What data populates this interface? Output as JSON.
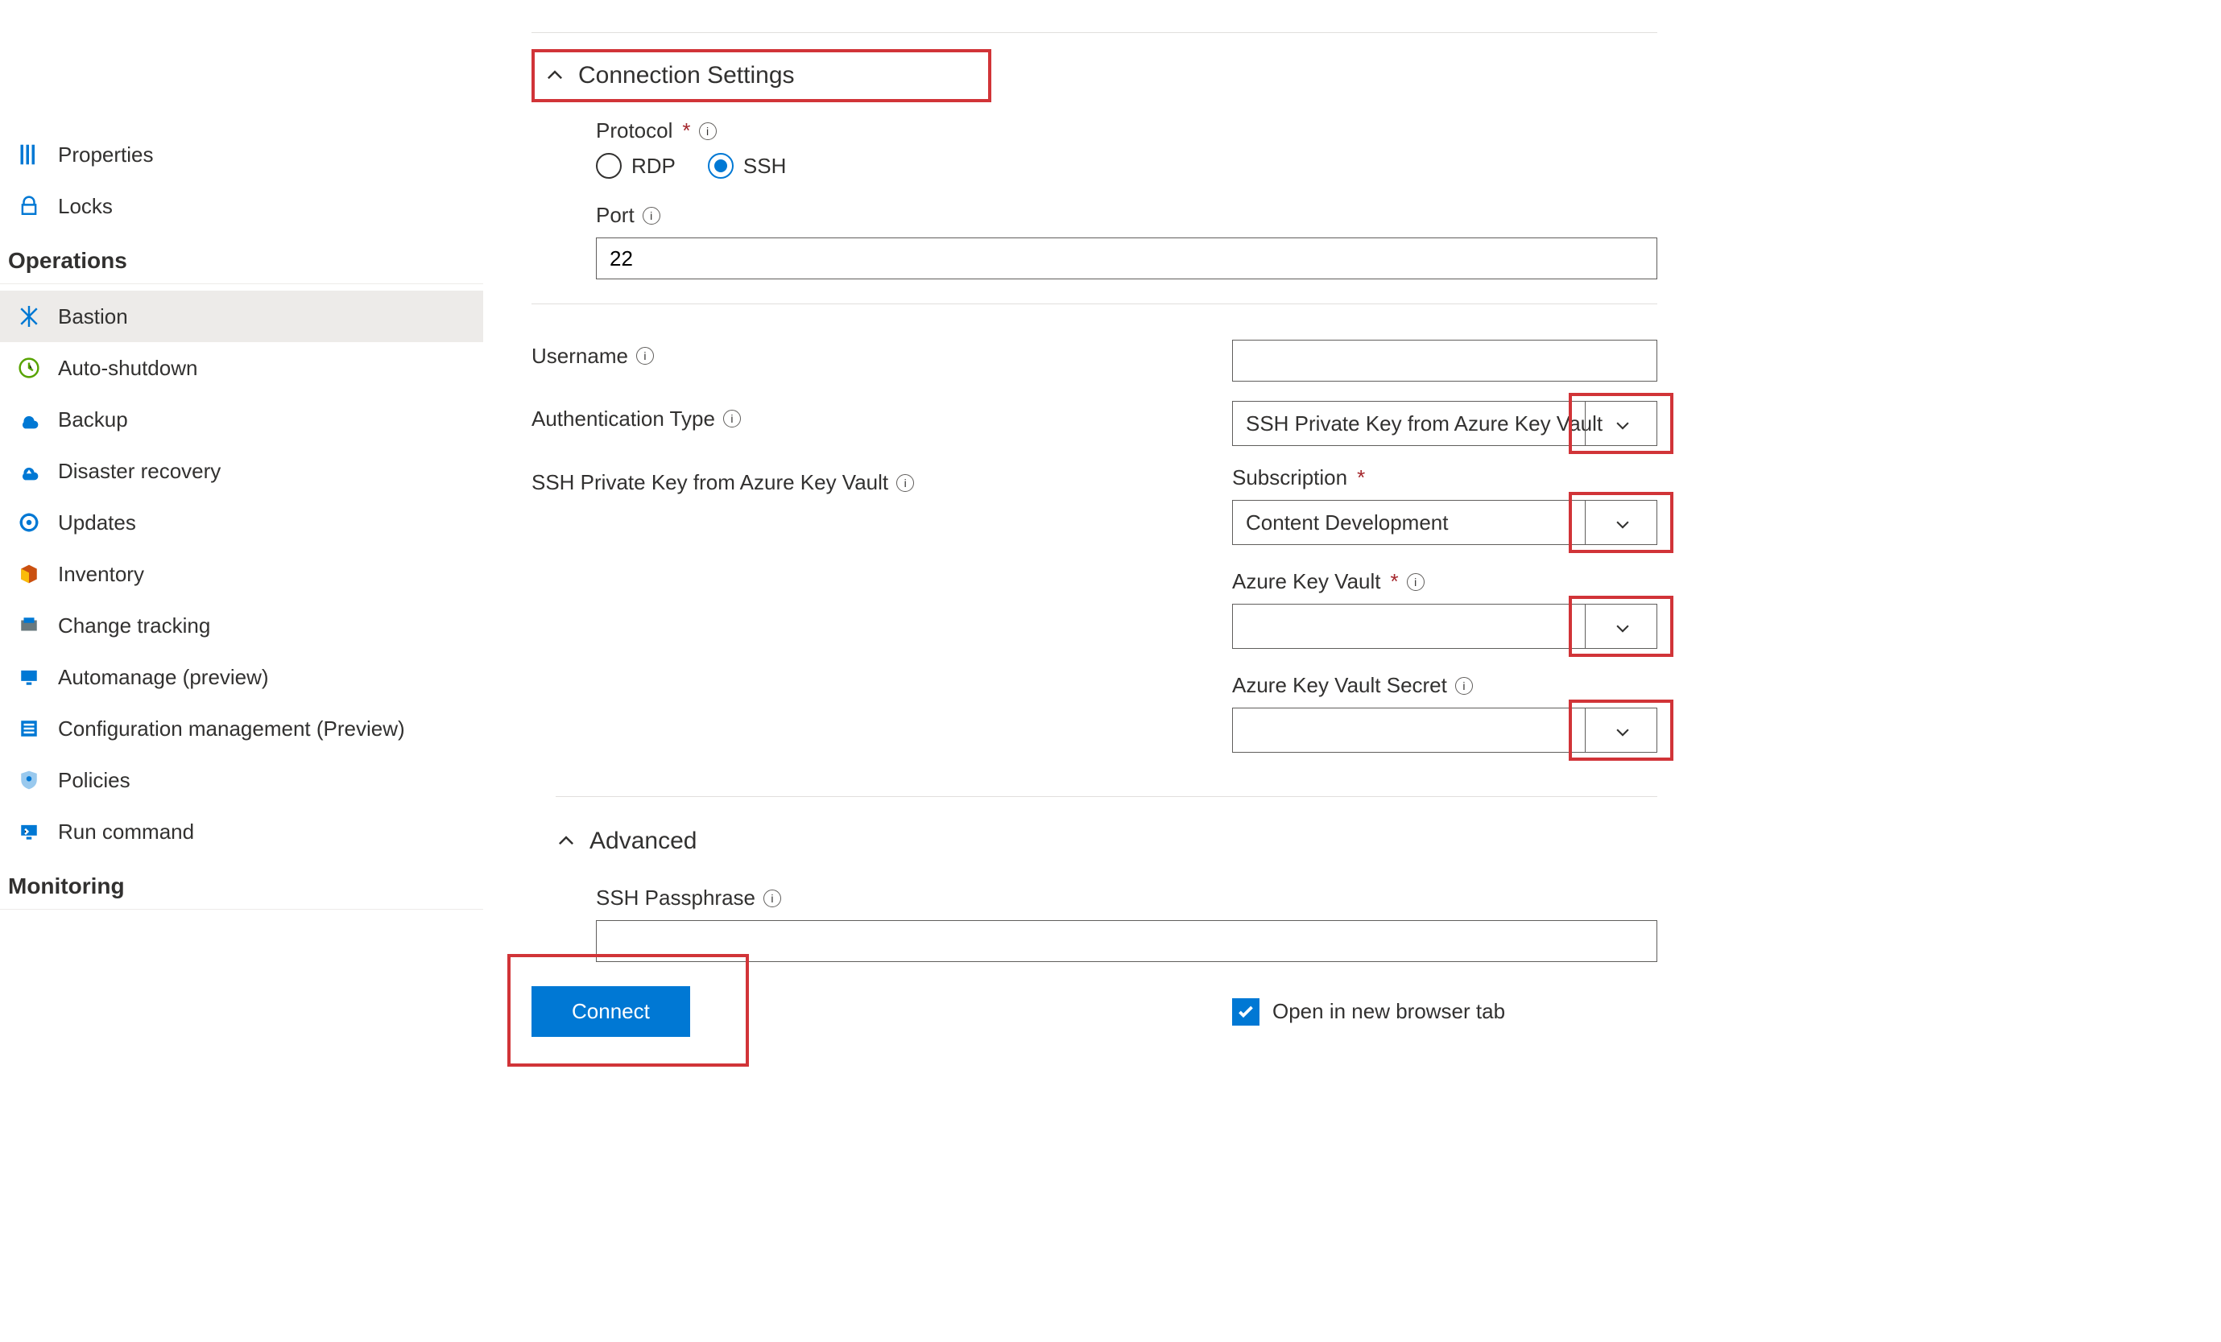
{
  "sidebar": {
    "items": [
      {
        "label": "Properties"
      },
      {
        "label": "Locks"
      }
    ],
    "operations_header": "Operations",
    "operations": [
      {
        "label": "Bastion"
      },
      {
        "label": "Auto-shutdown"
      },
      {
        "label": "Backup"
      },
      {
        "label": "Disaster recovery"
      },
      {
        "label": "Updates"
      },
      {
        "label": "Inventory"
      },
      {
        "label": "Change tracking"
      },
      {
        "label": "Automanage (preview)"
      },
      {
        "label": "Configuration management (Preview)"
      },
      {
        "label": "Policies"
      },
      {
        "label": "Run command"
      }
    ],
    "monitoring_header": "Monitoring"
  },
  "form": {
    "section_title": "Connection Settings",
    "protocol": {
      "label": "Protocol",
      "rdp": "RDP",
      "ssh": "SSH"
    },
    "port": {
      "label": "Port",
      "value": "22"
    },
    "username_label": "Username",
    "auth_type": {
      "label": "Authentication Type",
      "value": "SSH Private Key from Azure Key Vault"
    },
    "ssh_pk_label": "SSH Private Key from Azure Key Vault",
    "subscription": {
      "label": "Subscription",
      "value": "Content Development"
    },
    "akv_label": "Azure Key Vault",
    "akv_secret_label": "Azure Key Vault Secret",
    "advanced_title": "Advanced",
    "ssh_passphrase_label": "SSH Passphrase",
    "connect_label": "Connect",
    "open_new_tab_label": "Open in new browser tab"
  }
}
